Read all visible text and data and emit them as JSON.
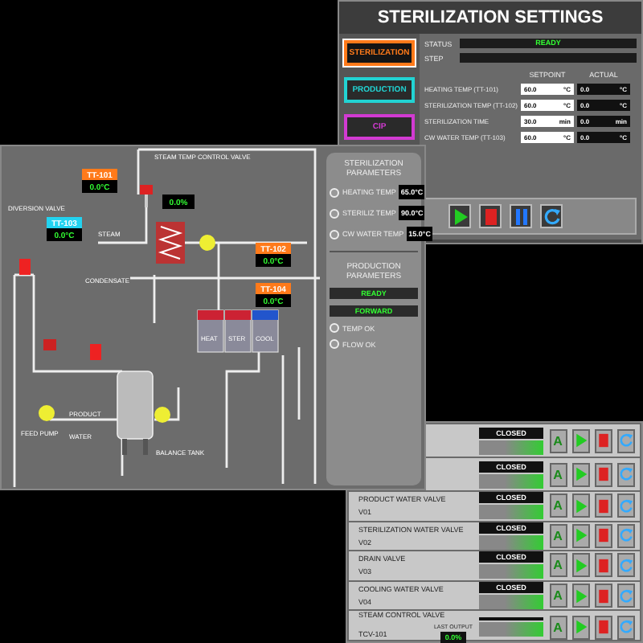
{
  "settings_window": {
    "title": "STERILIZATION SETTINGS",
    "tabs": [
      {
        "label": "STERILIZATION",
        "selected": true,
        "color": "#ff7a1a"
      },
      {
        "label": "PRODUCTION",
        "selected": false,
        "color": "#22d3d3"
      },
      {
        "label": "CIP",
        "selected": false,
        "color": "#d23ad2"
      }
    ],
    "status_label": "STATUS",
    "status": "READY",
    "step_label": "STEP",
    "setpoint_header": "SETPOINT",
    "actual_header": "ACTUAL",
    "rows": [
      {
        "label": "HEATING TEMP (TT-101)",
        "setpoint": "60.0",
        "setpoint_unit": "°C",
        "actual": "0.0",
        "actual_unit": "°C"
      },
      {
        "label": "STERILIZATION TEMP (TT-102)",
        "setpoint": "60.0",
        "setpoint_unit": "°C",
        "actual": "0.0",
        "actual_unit": "°C"
      },
      {
        "label": "STERILIZATION TIME",
        "setpoint": "30.0",
        "setpoint_unit": "min",
        "actual": "0.0",
        "actual_unit": "min"
      },
      {
        "label": "CW WATER TEMP (TT-103)",
        "setpoint": "60.0",
        "setpoint_unit": "°C",
        "actual": "0.0",
        "actual_unit": "°C"
      }
    ],
    "controls": [
      {
        "kind": "start"
      },
      {
        "kind": "stop"
      },
      {
        "kind": "pause"
      },
      {
        "kind": "reset"
      }
    ]
  },
  "process_window": {
    "tags": [
      {
        "name": "TT-101",
        "value": "0.0°C",
        "color": "#ff7a1a"
      },
      {
        "name": "TT-103",
        "value": "0.0°C",
        "color": "#22d3f0"
      },
      {
        "name": "TT-102",
        "value": "0.0°C",
        "color": "#ff7a1a"
      },
      {
        "name": "TT-104",
        "value": "0.0°C",
        "color": "#ff7a1a"
      }
    ],
    "valve_output": "0.0%",
    "labels": [
      {
        "text": "STEAM TEMP CONTROL VALVE"
      },
      {
        "text": "STEAM"
      },
      {
        "text": "CONDENSATE"
      },
      {
        "text": "DIVERSION VALVE"
      },
      {
        "text": "PRODUCT"
      },
      {
        "text": "WATER"
      },
      {
        "text": "BALANCE TANK"
      },
      {
        "text": "FEED PUMP"
      },
      {
        "text": "HEAT"
      },
      {
        "text": "STER"
      },
      {
        "text": "COOL"
      }
    ],
    "parameters": {
      "sterilization_title": "STERILIZATION PARAMETERS",
      "sterilization": [
        {
          "label": "HEATING TEMP",
          "value": "65.0°C",
          "on": false
        },
        {
          "label": "STERILIZ TEMP",
          "value": "90.0°C",
          "on": false
        },
        {
          "label": "CW WATER TEMP",
          "value": "15.0°C",
          "on": false
        }
      ],
      "production_title": "PRODUCTION PARAMETERS",
      "states": [
        "READY",
        "FORWARD"
      ],
      "checks": [
        {
          "label": "TEMP OK",
          "on": false
        },
        {
          "label": "FLOW OK",
          "on": false
        }
      ]
    }
  },
  "valve_window": {
    "rows": [
      {
        "status": "CLOSED",
        "mode_label": "A"
      },
      {
        "status": "CLOSED",
        "mode_label": "A"
      },
      {
        "label": "PRODUCT WATER VALVE",
        "tag": "V01",
        "status": "CLOSED",
        "mode_label": "A"
      },
      {
        "label": "STERILIZATION WATER VALVE",
        "tag": "V02",
        "status": "CLOSED",
        "mode_label": "A"
      },
      {
        "label": "DRAIN VALVE",
        "tag": "V03",
        "status": "CLOSED",
        "mode_label": "A"
      },
      {
        "label": "COOLING WATER VALVE",
        "tag": "V04",
        "status": "CLOSED",
        "mode_label": "A"
      },
      {
        "label": "STEAM CONTROL VALVE",
        "tag": "TCV-101",
        "output_label": "LAST OUTPUT",
        "output": "0.0%",
        "mode_label": "A"
      }
    ]
  }
}
